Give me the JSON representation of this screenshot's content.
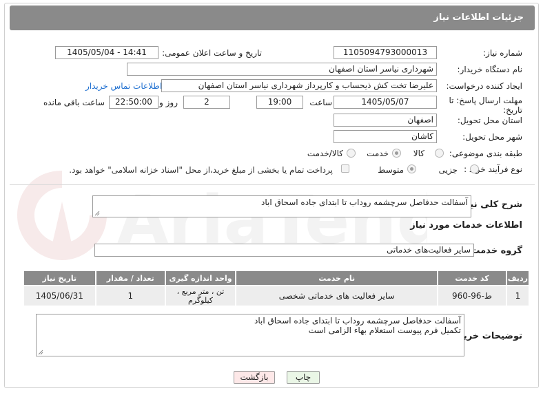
{
  "header": {
    "title": "جزئیات اطلاعات نیاز"
  },
  "form": {
    "need_number_label": "شماره نیاز:",
    "need_number": "1105094793000013",
    "announce_label": "تاریخ و ساعت اعلان عمومی:",
    "announce_value": "1405/05/04 - 14:41",
    "buyer_label": "نام دستگاه خریدار:",
    "buyer_value": "شهرداری نیاسر استان اصفهان",
    "creator_label": "ایجاد کننده درخواست:",
    "creator_value": "علیرضا  تخت کش ذیحساب و کارپرداز شهرداری نیاسر استان اصفهان",
    "contact_link": "اطلاعات تماس خریدار",
    "deadline_label": "مهلت ارسال پاسخ: تا تاریخ:",
    "deadline_date": "1405/05/07",
    "time_label": "ساعت",
    "deadline_time": "19:00",
    "days_value": "2",
    "days_label": "روز و",
    "remaining_value": "22:50:00",
    "remaining_label": "ساعت باقی مانده",
    "province_label": "استان محل تحویل:",
    "province_value": "اصفهان",
    "city_label": "شهر محل تحویل:",
    "city_value": "کاشان",
    "category_label": "طبقه بندی موضوعی:",
    "category_options": [
      "کالا",
      "خدمت",
      "کالا/خدمت"
    ],
    "category_selected": "خدمت",
    "process_label": "نوع فرآیند خرید :",
    "process_options": [
      "جزیی",
      "متوسط"
    ],
    "process_selected": "متوسط",
    "payment_note": "پرداخت تمام یا بخشی از مبلغ خرید،از محل \"اسناد خزانه اسلامی\" خواهد بود."
  },
  "summary": {
    "label": "شرح کلی نیاز:",
    "value": "آسفالت حدفاصل سرچشمه روداب تا ابتدای جاده اسحاق اباد"
  },
  "services": {
    "section_title": "اطلاعات خدمات مورد نیاز",
    "group_label": "گروه خدمت:",
    "group_value": "سایر فعالیت‌های خدماتی",
    "columns": [
      "ردیف",
      "کد خدمت",
      "نام خدمت",
      "واحد اندازه گیری",
      "تعداد / مقدار",
      "تاریخ نیاز"
    ],
    "rows": [
      {
        "idx": "1",
        "code": "ط-96-960",
        "name": "سایر فعالیت های خدماتی شخصی",
        "unit": "تن ، متر مربع ، کیلوگرم",
        "qty": "1",
        "date": "1405/06/31"
      }
    ]
  },
  "buyer_notes": {
    "label": "توضیحات خریدار:",
    "line1": "آسفالت حدفاصل سرچشمه روداب تا ابتدای جاده اسحاق اباد",
    "line2": "تکمیل فرم پیوست استعلام بهاء الزامی است"
  },
  "buttons": {
    "print": "چاپ",
    "back": "بازگشت"
  },
  "watermark": {
    "text": "AriaTender.neT"
  }
}
